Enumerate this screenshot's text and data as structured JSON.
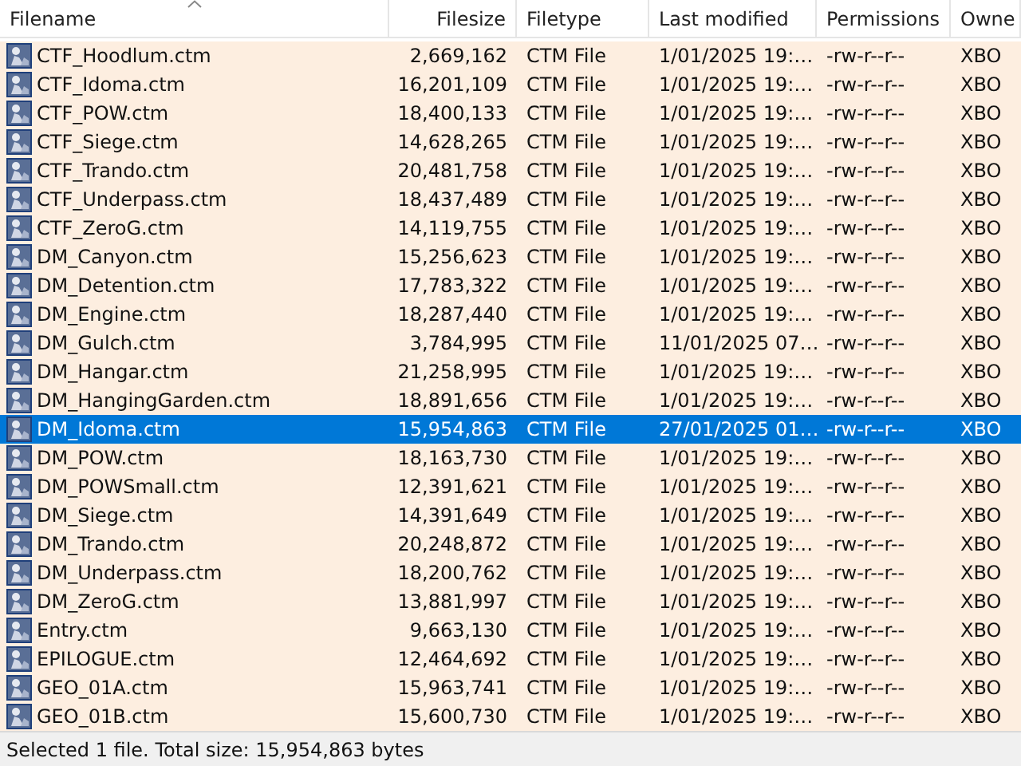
{
  "columns": [
    {
      "label": "Filename",
      "sorted": true
    },
    {
      "label": "Filesize",
      "sorted": false
    },
    {
      "label": "Filetype",
      "sorted": false
    },
    {
      "label": "Last modified",
      "sorted": false
    },
    {
      "label": "Permissions",
      "sorted": false
    },
    {
      "label": "Owne",
      "sorted": false
    }
  ],
  "rows": [
    {
      "cells": [
        "CTF_Hoodlum.ctm",
        "2,669,162",
        "CTM File",
        "1/01/2025 19:…",
        "-rw-r--r--",
        "XBO"
      ],
      "selected": false
    },
    {
      "cells": [
        "CTF_Idoma.ctm",
        "16,201,109",
        "CTM File",
        "1/01/2025 19:…",
        "-rw-r--r--",
        "XBO"
      ],
      "selected": false
    },
    {
      "cells": [
        "CTF_POW.ctm",
        "18,400,133",
        "CTM File",
        "1/01/2025 19:…",
        "-rw-r--r--",
        "XBO"
      ],
      "selected": false
    },
    {
      "cells": [
        "CTF_Siege.ctm",
        "14,628,265",
        "CTM File",
        "1/01/2025 19:…",
        "-rw-r--r--",
        "XBO"
      ],
      "selected": false
    },
    {
      "cells": [
        "CTF_Trando.ctm",
        "20,481,758",
        "CTM File",
        "1/01/2025 19:…",
        "-rw-r--r--",
        "XBO"
      ],
      "selected": false
    },
    {
      "cells": [
        "CTF_Underpass.ctm",
        "18,437,489",
        "CTM File",
        "1/01/2025 19:…",
        "-rw-r--r--",
        "XBO"
      ],
      "selected": false
    },
    {
      "cells": [
        "CTF_ZeroG.ctm",
        "14,119,755",
        "CTM File",
        "1/01/2025 19:…",
        "-rw-r--r--",
        "XBO"
      ],
      "selected": false
    },
    {
      "cells": [
        "DM_Canyon.ctm",
        "15,256,623",
        "CTM File",
        "1/01/2025 19:…",
        "-rw-r--r--",
        "XBO"
      ],
      "selected": false
    },
    {
      "cells": [
        "DM_Detention.ctm",
        "17,783,322",
        "CTM File",
        "1/01/2025 19:…",
        "-rw-r--r--",
        "XBO"
      ],
      "selected": false
    },
    {
      "cells": [
        "DM_Engine.ctm",
        "18,287,440",
        "CTM File",
        "1/01/2025 19:…",
        "-rw-r--r--",
        "XBO"
      ],
      "selected": false
    },
    {
      "cells": [
        "DM_Gulch.ctm",
        "3,784,995",
        "CTM File",
        "11/01/2025 07…",
        "-rw-r--r--",
        "XBO"
      ],
      "selected": false
    },
    {
      "cells": [
        "DM_Hangar.ctm",
        "21,258,995",
        "CTM File",
        "1/01/2025 19:…",
        "-rw-r--r--",
        "XBO"
      ],
      "selected": false
    },
    {
      "cells": [
        "DM_HangingGarden.ctm",
        "18,891,656",
        "CTM File",
        "1/01/2025 19:…",
        "-rw-r--r--",
        "XBO"
      ],
      "selected": false
    },
    {
      "cells": [
        "DM_Idoma.ctm",
        "15,954,863",
        "CTM File",
        "27/01/2025 01…",
        "-rw-r--r--",
        "XBO"
      ],
      "selected": true
    },
    {
      "cells": [
        "DM_POW.ctm",
        "18,163,730",
        "CTM File",
        "1/01/2025 19:…",
        "-rw-r--r--",
        "XBO"
      ],
      "selected": false
    },
    {
      "cells": [
        "DM_POWSmall.ctm",
        "12,391,621",
        "CTM File",
        "1/01/2025 19:…",
        "-rw-r--r--",
        "XBO"
      ],
      "selected": false
    },
    {
      "cells": [
        "DM_Siege.ctm",
        "14,391,649",
        "CTM File",
        "1/01/2025 19:…",
        "-rw-r--r--",
        "XBO"
      ],
      "selected": false
    },
    {
      "cells": [
        "DM_Trando.ctm",
        "20,248,872",
        "CTM File",
        "1/01/2025 19:…",
        "-rw-r--r--",
        "XBO"
      ],
      "selected": false
    },
    {
      "cells": [
        "DM_Underpass.ctm",
        "18,200,762",
        "CTM File",
        "1/01/2025 19:…",
        "-rw-r--r--",
        "XBO"
      ],
      "selected": false
    },
    {
      "cells": [
        "DM_ZeroG.ctm",
        "13,881,997",
        "CTM File",
        "1/01/2025 19:…",
        "-rw-r--r--",
        "XBO"
      ],
      "selected": false
    },
    {
      "cells": [
        "Entry.ctm",
        "9,663,130",
        "CTM File",
        "1/01/2025 19:…",
        "-rw-r--r--",
        "XBO"
      ],
      "selected": false
    },
    {
      "cells": [
        "EPILOGUE.ctm",
        "12,464,692",
        "CTM File",
        "1/01/2025 19:…",
        "-rw-r--r--",
        "XBO"
      ],
      "selected": false
    },
    {
      "cells": [
        "GEO_01A.ctm",
        "15,963,741",
        "CTM File",
        "1/01/2025 19:…",
        "-rw-r--r--",
        "XBO"
      ],
      "selected": false
    },
    {
      "cells": [
        "GEO_01B.ctm",
        "15,600,730",
        "CTM File",
        "1/01/2025 19:…",
        "-rw-r--r--",
        "XBO"
      ],
      "selected": false
    }
  ],
  "status_bar": "Selected 1 file. Total size: 15,954,863 bytes"
}
